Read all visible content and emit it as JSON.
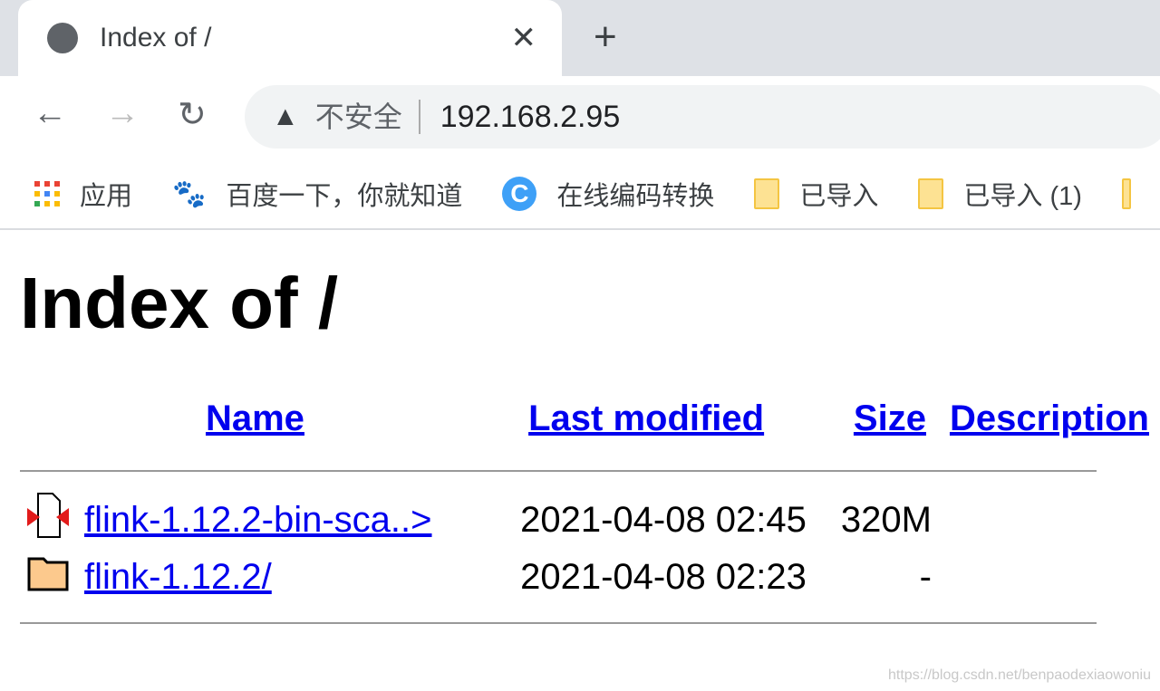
{
  "browser": {
    "tab": {
      "title": "Index of /",
      "icon": "globe-icon"
    },
    "address": {
      "security_label": "不安全",
      "url": "192.168.2.95"
    },
    "bookmarks": [
      {
        "label": "应用",
        "icon": "apps-grid-icon"
      },
      {
        "label": "百度一下，你就知道",
        "icon": "baidu-paw-icon"
      },
      {
        "label": "在线编码转换",
        "icon": "c-logo-icon"
      },
      {
        "label": "已导入",
        "icon": "folder-icon"
      },
      {
        "label": "已导入 (1)",
        "icon": "folder-icon"
      }
    ]
  },
  "page": {
    "heading": "Index of /",
    "columns": {
      "name": "Name",
      "modified": "Last modified",
      "size": "Size",
      "description": "Description"
    },
    "rows": [
      {
        "name": "flink-1.12.2-bin-sca..>",
        "modified": "2021-04-08 02:45",
        "size": "320M",
        "description": "",
        "icon": "compressed-file-icon"
      },
      {
        "name": "flink-1.12.2/",
        "modified": "2021-04-08 02:23",
        "size": "-",
        "description": "",
        "icon": "folder-icon"
      }
    ]
  },
  "watermark": "https://blog.csdn.net/benpaodexiaowoniu"
}
